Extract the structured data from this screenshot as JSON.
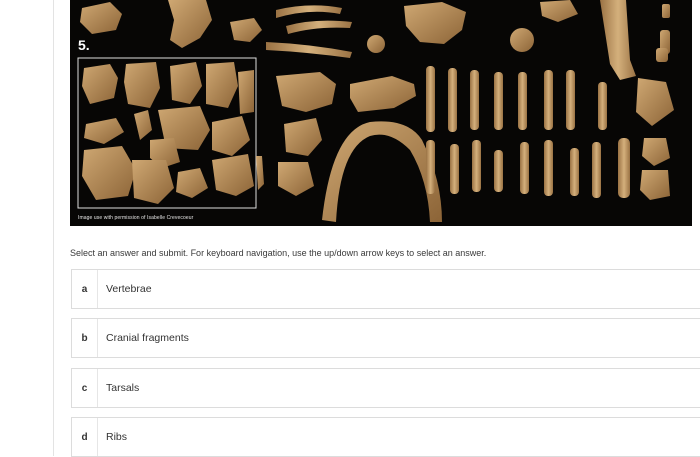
{
  "question": {
    "number": "5.",
    "image_credit": "Image use with permission of Isabelle Crevecoeur",
    "instructions": "Select an answer and submit. For keyboard navigation, use the up/down arrow keys to select an answer."
  },
  "options": [
    {
      "letter": "a",
      "label": "Vertebrae"
    },
    {
      "letter": "b",
      "label": "Cranial fragments"
    },
    {
      "letter": "c",
      "label": "Tarsals"
    },
    {
      "letter": "d",
      "label": "Ribs"
    }
  ],
  "colors": {
    "photo_background": "#070605",
    "bone": "#b88f5d",
    "highlight_box": "#dddddd"
  }
}
